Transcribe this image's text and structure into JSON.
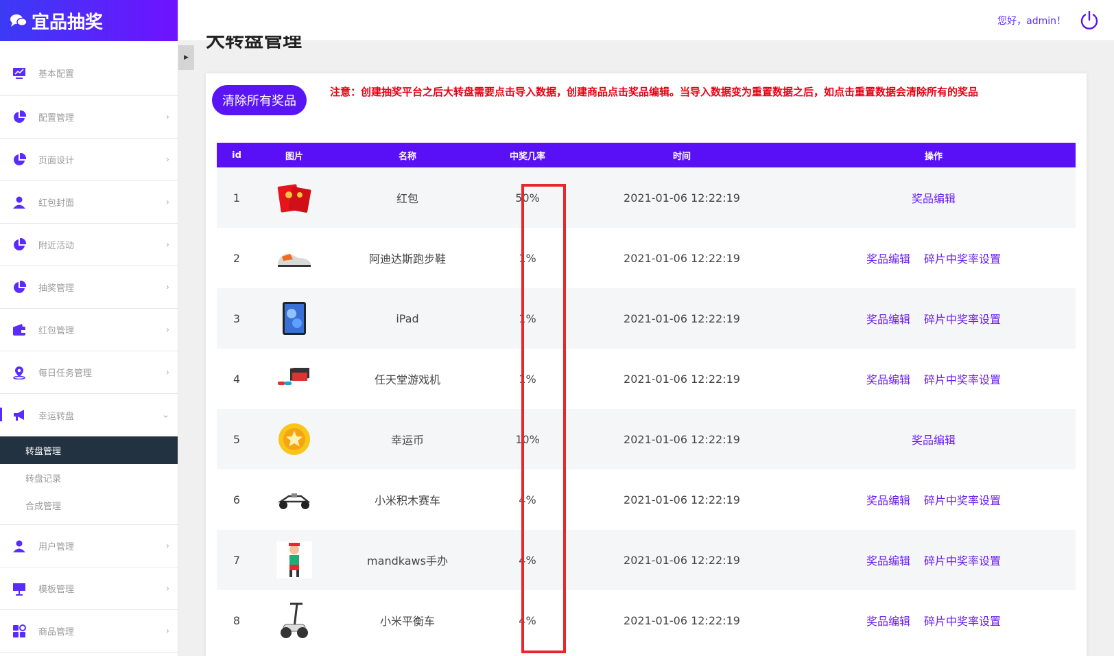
{
  "brand": {
    "title": "宜品抽奖",
    "icon": "chat-bubbles-icon"
  },
  "sidebar": {
    "items": [
      {
        "label": "基本配置",
        "icon": "dashboard-chart-icon",
        "has_children": false
      },
      {
        "label": "配置管理",
        "icon": "pie-chart-icon",
        "has_children": true
      },
      {
        "label": "页面设计",
        "icon": "pie-chart-icon",
        "has_children": true
      },
      {
        "label": "红包封面",
        "icon": "user-icon",
        "has_children": true
      },
      {
        "label": "附近活动",
        "icon": "pie-chart-icon",
        "has_children": true
      },
      {
        "label": "抽奖管理",
        "icon": "pie-chart-icon",
        "has_children": true
      },
      {
        "label": "红包管理",
        "icon": "wallet-icon",
        "has_children": true
      },
      {
        "label": "每日任务管理",
        "icon": "location-pin-icon",
        "has_children": true
      },
      {
        "label": "幸运转盘",
        "icon": "megaphone-icon",
        "has_children": true,
        "expanded": true
      },
      {
        "label": "用户管理",
        "icon": "user-icon",
        "has_children": true
      },
      {
        "label": "模板管理",
        "icon": "presentation-board-icon",
        "has_children": true
      },
      {
        "label": "商品管理",
        "icon": "grid-apps-icon",
        "has_children": true
      }
    ],
    "submenu": [
      {
        "label": "转盘管理",
        "active": true
      },
      {
        "label": "转盘记录",
        "active": false
      },
      {
        "label": "合成管理",
        "active": false
      }
    ]
  },
  "topbar": {
    "greeting": "您好，admin！",
    "power_icon": "power-icon"
  },
  "page": {
    "title": "大转盘管理"
  },
  "actions": {
    "clear_button": "清除所有奖品"
  },
  "notice": "注意：创建抽奖平台之后大转盘需要点击导入数据，创建商品点击奖品编辑。当导入数据变为重置数据之后，如点击重置数据会清除所有的奖品",
  "table": {
    "headers": [
      "id",
      "图片",
      "名称",
      "中奖几率",
      "时间",
      "操作"
    ],
    "rows": [
      {
        "id": "1",
        "image": "red-envelope-image",
        "name": "红包",
        "rate": "50%",
        "time": "2021-01-06 12:22:19",
        "ops": [
          "奖品编辑"
        ]
      },
      {
        "id": "2",
        "image": "sneaker-image",
        "name": "阿迪达斯跑步鞋",
        "rate": "1%",
        "time": "2021-01-06 12:22:19",
        "ops": [
          "奖品编辑",
          "碎片中奖率设置"
        ]
      },
      {
        "id": "3",
        "image": "ipad-image",
        "name": "iPad",
        "rate": "1%",
        "time": "2021-01-06 12:22:19",
        "ops": [
          "奖品编辑",
          "碎片中奖率设置"
        ]
      },
      {
        "id": "4",
        "image": "game-console-image",
        "name": "任天堂游戏机",
        "rate": "1%",
        "time": "2021-01-06 12:22:19",
        "ops": [
          "奖品编辑",
          "碎片中奖率设置"
        ]
      },
      {
        "id": "5",
        "image": "lucky-coin-image",
        "name": "幸运币",
        "rate": "10%",
        "time": "2021-01-06 12:22:19",
        "ops": [
          "奖品编辑"
        ]
      },
      {
        "id": "6",
        "image": "kart-image",
        "name": "小米积木赛车",
        "rate": "4%",
        "time": "2021-01-06 12:22:19",
        "ops": [
          "奖品编辑",
          "碎片中奖率设置"
        ]
      },
      {
        "id": "7",
        "image": "figure-toy-image",
        "name": "mandkaws手办",
        "rate": "4%",
        "time": "2021-01-06 12:22:19",
        "ops": [
          "奖品编辑",
          "碎片中奖率设置"
        ]
      },
      {
        "id": "8",
        "image": "balance-scooter-image",
        "name": "小米平衡车",
        "rate": "4%",
        "time": "2021-01-06 12:22:19",
        "ops": [
          "奖品编辑",
          "碎片中奖率设置"
        ]
      }
    ]
  },
  "colors": {
    "accent": "#5a10f7",
    "notice": "#e60012",
    "highlight": "#e8262a",
    "sidebar_active": "#233240"
  }
}
